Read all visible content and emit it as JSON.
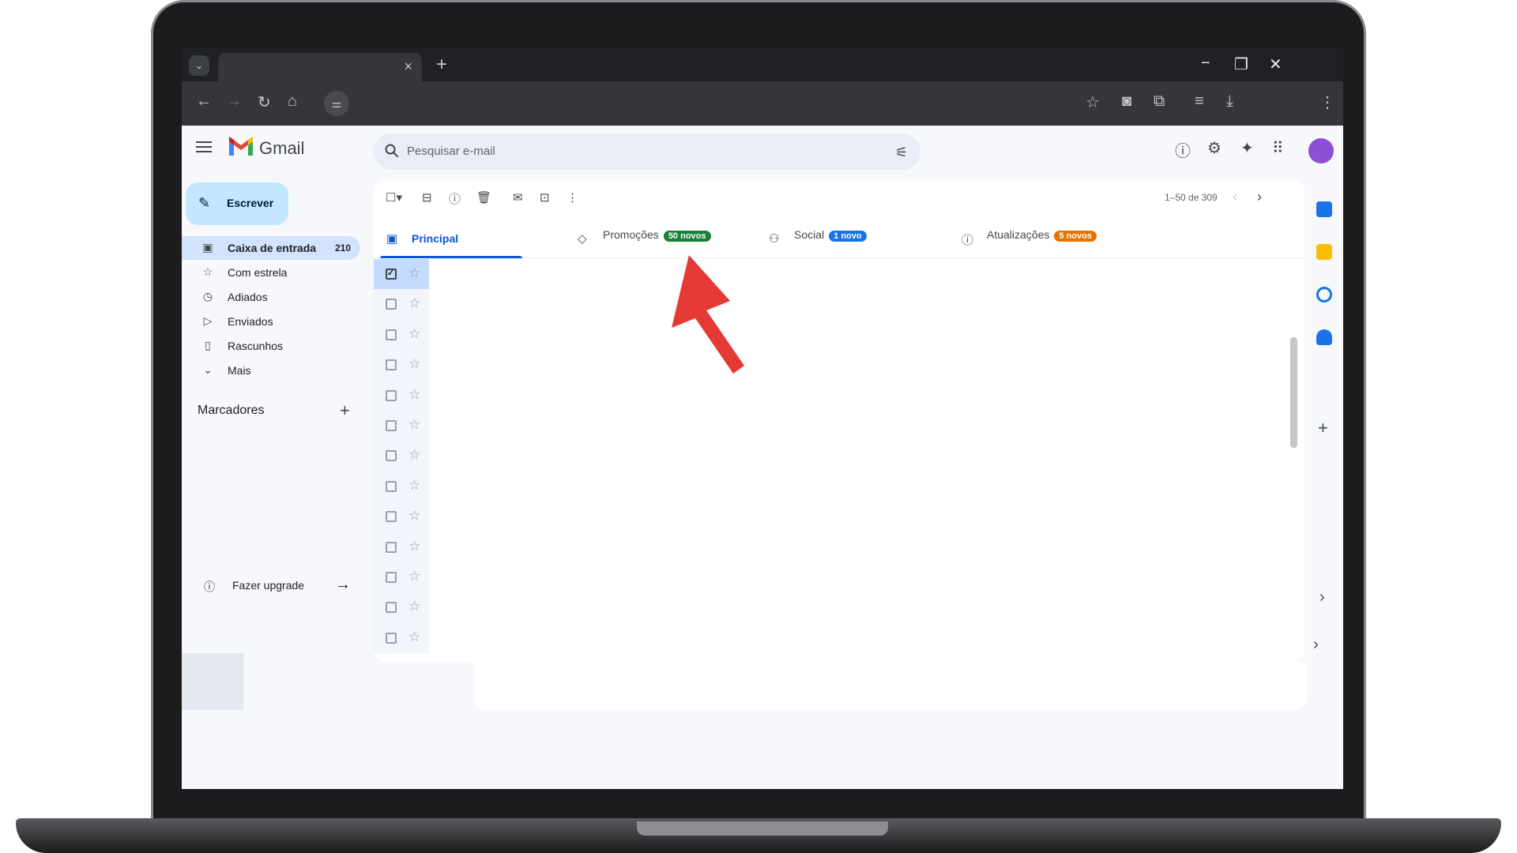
{
  "browser": {
    "tab_title": "",
    "new_tab": "+",
    "controls": {
      "minimize": "−",
      "restore": "❐",
      "close": "✕"
    }
  },
  "gmail": {
    "app_name": "Gmail",
    "search": {
      "placeholder": "Pesquisar e-mail"
    },
    "compose_label": "Escrever",
    "nav": [
      {
        "label": "Caixa de entrada",
        "count": "210",
        "icon": "inbox-icon"
      },
      {
        "label": "Com estrela",
        "icon": "star-icon"
      },
      {
        "label": "Adiados",
        "icon": "clock-icon"
      },
      {
        "label": "Enviados",
        "icon": "send-icon"
      },
      {
        "label": "Rascunhos",
        "icon": "draft-icon"
      },
      {
        "label": "Mais",
        "icon": "chevron-down-icon"
      }
    ],
    "labels_title": "Marcadores",
    "upgrade_label": "Fazer upgrade",
    "pagination": "1–50 de 309",
    "tabs": [
      {
        "label": "Principal",
        "active": true
      },
      {
        "label": "Promoções",
        "badge": "50 novos",
        "badge_color": "#188038"
      },
      {
        "label": "Social",
        "badge": "1 novo",
        "badge_color": "#1a73e8"
      },
      {
        "label": "Atualizações",
        "badge": "5 novos",
        "badge_color": "#e37400"
      }
    ],
    "row_count": 13,
    "checked_rows": 1,
    "colors": {
      "accent": "#0b57d0",
      "compose": "#c2e7ff",
      "arrow": "#e53935"
    }
  }
}
